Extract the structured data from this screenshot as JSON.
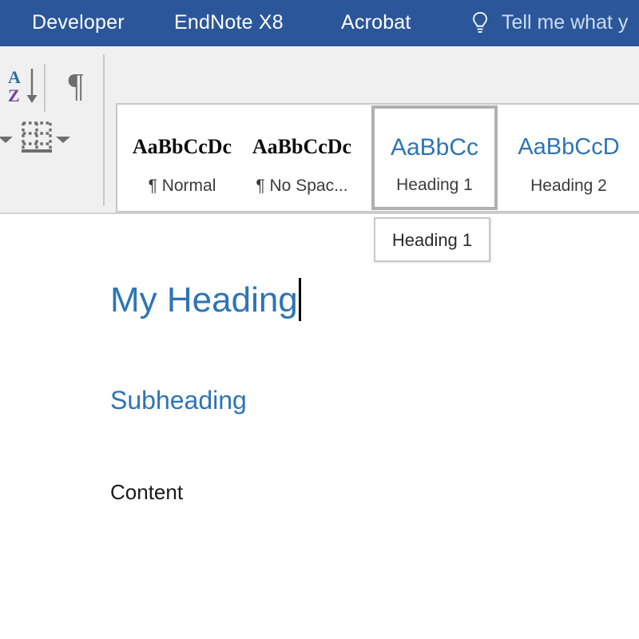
{
  "ribbon": {
    "background_color": "#2b579a",
    "tabs": [
      {
        "label": "Developer",
        "active": false
      },
      {
        "label": "EndNote X8",
        "active": false
      },
      {
        "label": "Acrobat",
        "active": false
      }
    ],
    "tell_me": {
      "label": "Tell me what y",
      "icon": "lightbulb-icon"
    }
  },
  "paragraph_group": {
    "sort_icon": "sort-az-icon",
    "show_marks_icon": "pilcrow-icon",
    "shading_dropdown_icon": "chevron-down-icon",
    "borders_icon": "bottom-border-icon",
    "borders_dropdown_icon": "chevron-down-icon",
    "dialog_launcher_icon": "dialog-launcher-icon"
  },
  "styles_gallery": {
    "items": [
      {
        "preview": "AaBbCcDc",
        "label": "¶ Normal",
        "selected": false,
        "kind": "body"
      },
      {
        "preview": "AaBbCcDc",
        "label": "¶ No Spac...",
        "selected": false,
        "kind": "body"
      },
      {
        "preview": "AaBbCc",
        "label": "Heading 1",
        "selected": true,
        "kind": "h1"
      },
      {
        "preview": "AaBbCcD",
        "label": "Heading 2",
        "selected": false,
        "kind": "h2"
      }
    ]
  },
  "tooltip": {
    "text": "Heading 1"
  },
  "document": {
    "heading1": "My Heading",
    "heading2": "Subheading",
    "body": "Content",
    "heading_color": "#2e74b5",
    "body_color": "#1a1a1a",
    "caret_visible": true
  }
}
